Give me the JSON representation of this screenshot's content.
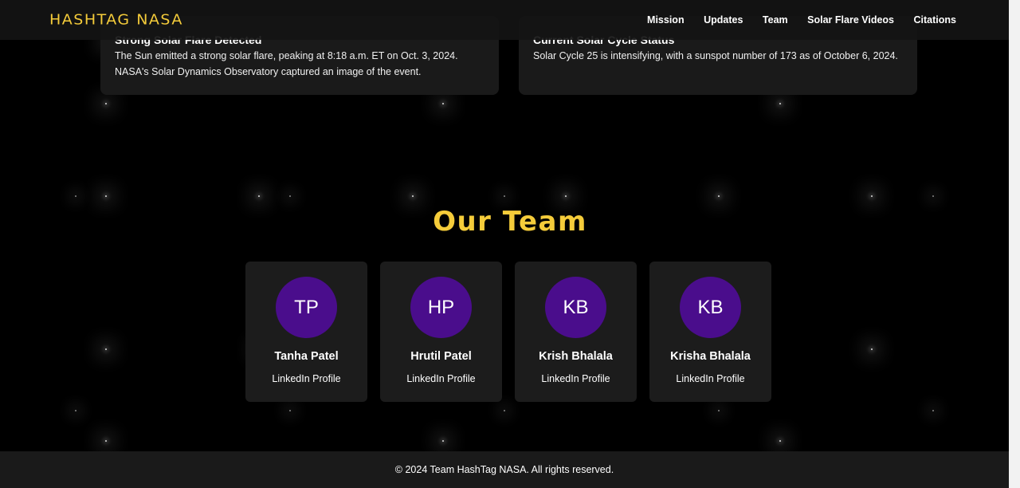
{
  "header": {
    "logo": "HASHTAG NASA",
    "nav": [
      "Mission",
      "Updates",
      "Team",
      "Solar Flare Videos",
      "Citations"
    ]
  },
  "updates": [
    {
      "title": "Strong Solar Flare Detected",
      "body": "The Sun emitted a strong solar flare, peaking at 8:18 a.m. ET on Oct. 3, 2024. NASA's Solar Dynamics Observatory captured an image of the event."
    },
    {
      "title": "Current Solar Cycle Status",
      "body": "Solar Cycle 25 is intensifying, with a sunspot number of 173 as of October 6, 2024."
    }
  ],
  "team": {
    "heading": "Our Team",
    "members": [
      {
        "initials": "TP",
        "name": "Tanha Patel",
        "link": "LinkedIn Profile"
      },
      {
        "initials": "HP",
        "name": "Hrutil Patel",
        "link": "LinkedIn Profile"
      },
      {
        "initials": "KB",
        "name": "Krish Bhalala",
        "link": "LinkedIn Profile"
      },
      {
        "initials": "KB",
        "name": "Krisha Bhalala",
        "link": "LinkedIn Profile"
      }
    ]
  },
  "footer": {
    "text": "© 2024 Team HashTag NASA. All rights reserved."
  },
  "colors": {
    "accent": "#f5cc3a",
    "avatar": "#4a0d8c",
    "card": "#1c1c1c",
    "background": "#000000"
  }
}
